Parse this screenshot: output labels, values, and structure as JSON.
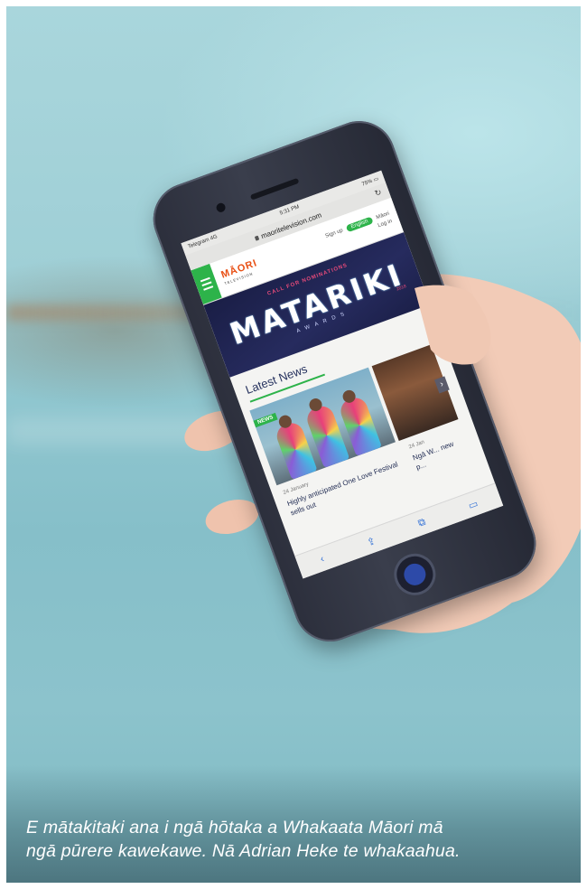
{
  "caption": {
    "line1": "E mātakitaki ana i ngā hōtaka a Whakaata Māori mā",
    "line2": "ngā pūrere kawekawe. Nā Adrian Heke te whakaahua."
  },
  "phone": {
    "status": {
      "carrier": "Telegram 4G",
      "time": "5:31 PM",
      "battery": "75% ▭"
    },
    "url": "maoritelevision.com",
    "reload_icon": "reload-icon",
    "site": {
      "logo_main": "MĀORI",
      "logo_sub": "TELEVISION",
      "signup": "Sign up",
      "login": "Log in",
      "lang_on": "English",
      "lang_off": "Māori"
    },
    "banner": {
      "call": "CALL FOR NOMINATIONS",
      "title": "MATARIKI",
      "sub": "AWARDS",
      "year": "2018"
    },
    "news": {
      "heading": "Latest News",
      "tag": "NEWS",
      "date1": "24 January",
      "headline1": "Highly anticipated One Love Festival sells out",
      "date2": "24 Jan",
      "headline2": "Ngā W... new p..."
    },
    "toolbar": [
      "‹",
      "⇪",
      "⧉",
      "▭"
    ]
  }
}
